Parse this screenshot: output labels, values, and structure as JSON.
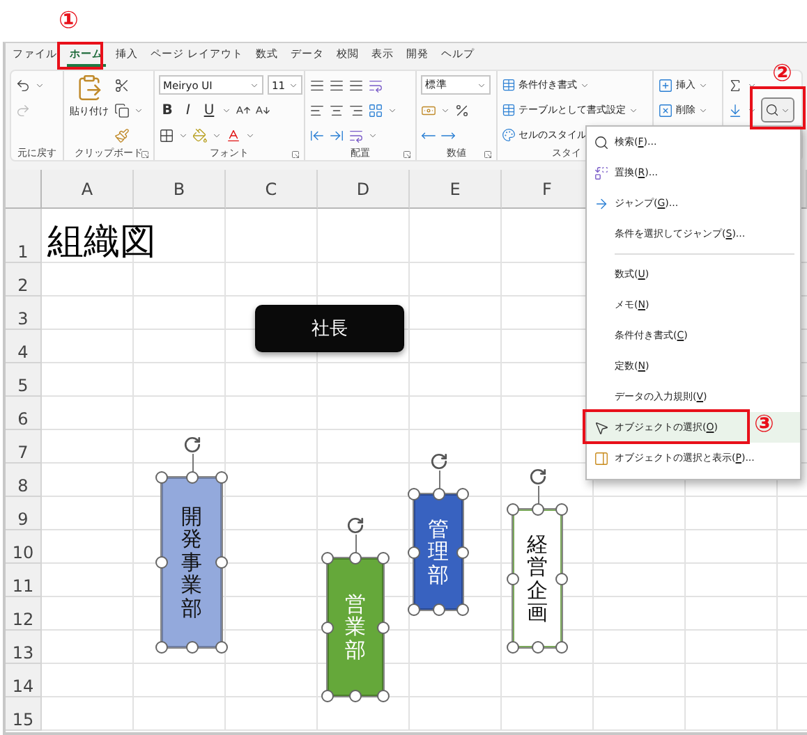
{
  "annotations": [
    {
      "label": "①"
    },
    {
      "label": "②"
    },
    {
      "label": "③"
    }
  ],
  "tabs": [
    {
      "label": "ファイル",
      "selected": false
    },
    {
      "label": "ホーム",
      "selected": true
    },
    {
      "label": "挿入",
      "selected": false
    },
    {
      "label": "ページ レイアウト",
      "selected": false
    },
    {
      "label": "数式",
      "selected": false
    },
    {
      "label": "データ",
      "selected": false
    },
    {
      "label": "校閲",
      "selected": false
    },
    {
      "label": "表示",
      "selected": false
    },
    {
      "label": "開発",
      "selected": false
    },
    {
      "label": "ヘルプ",
      "selected": false
    }
  ],
  "ribbon": {
    "undo_group": {
      "label": "元に戻す"
    },
    "clipboard_group": {
      "label": "クリップボード",
      "paste": "貼り付け"
    },
    "font_group": {
      "label": "フォント",
      "font_name": "Meiryo UI",
      "font_size": "11",
      "format_buttons": [
        "B",
        "I",
        "U"
      ]
    },
    "alignment_group": {
      "label": "配置"
    },
    "number_group": {
      "label": "数値",
      "format": "標準"
    },
    "styles_group": {
      "label": "スタイ",
      "buttons": [
        "条件付き書式",
        "テーブルとして書式設定",
        "セルのスタイル"
      ]
    },
    "cells_group": {
      "buttons": [
        "挿入",
        "削除"
      ]
    }
  },
  "find_menu": {
    "groups": [
      [
        {
          "before": "検索(",
          "key": "F",
          "after": ")...",
          "selected": false
        },
        {
          "before": "置換(",
          "key": "R",
          "after": ")...",
          "selected": false
        },
        {
          "before": "ジャンプ(",
          "key": "G",
          "after": ")...",
          "selected": false
        },
        {
          "before": "条件を選択してジャンプ(",
          "key": "S",
          "after": ")...",
          "selected": false
        }
      ],
      [
        {
          "before": "数式(",
          "key": "U",
          "after": ")",
          "selected": false
        },
        {
          "before": "メモ(",
          "key": "N",
          "after": ")",
          "selected": false
        },
        {
          "before": "条件付き書式(",
          "key": "C",
          "after": ")",
          "selected": false
        },
        {
          "before": "定数(",
          "key": "N",
          "after": ")",
          "selected": false
        },
        {
          "before": "データの入力規則(",
          "key": "V",
          "after": ")",
          "selected": false
        },
        {
          "before": "オブジェクトの選択(",
          "key": "O",
          "after": ")",
          "selected": true
        },
        {
          "before": "オブジェクトの選択と表示(",
          "key": "P",
          "after": ")...",
          "selected": false
        }
      ]
    ]
  },
  "sheet": {
    "columns": [
      "A",
      "B",
      "C",
      "D",
      "E",
      "F"
    ],
    "rows": [
      "1",
      "2",
      "3",
      "4",
      "5",
      "6",
      "7",
      "8",
      "9",
      "10",
      "11",
      "12",
      "13",
      "14",
      "15"
    ],
    "title": "組織図",
    "shapes": [
      {
        "kind": "horizontal",
        "text": "社長",
        "color": "#0a0a0a",
        "selected": false
      },
      {
        "kind": "vertical",
        "text": "開発事業部",
        "color": "#93a9dc",
        "selected": true
      },
      {
        "kind": "vertical",
        "text": "営業部",
        "color": "#65a83a",
        "selected": true
      },
      {
        "kind": "vertical",
        "text": "管理部",
        "color": "#3862c0",
        "selected": true
      },
      {
        "kind": "vertical",
        "text": "経営企画",
        "color": "#ffffff",
        "selected": true
      }
    ]
  }
}
